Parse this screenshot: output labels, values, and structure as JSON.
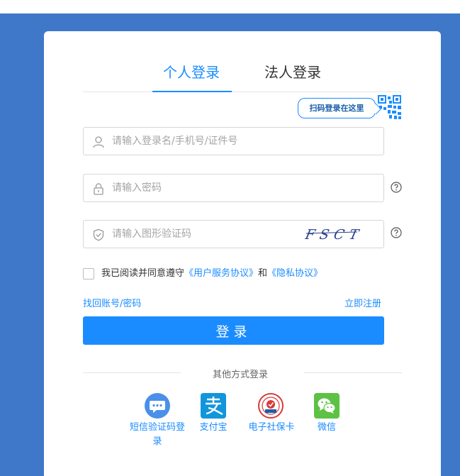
{
  "tabs": [
    {
      "label": "个人登录"
    },
    {
      "label": "法人登录"
    }
  ],
  "qr": {
    "bubble_text": "扫码登录在这里"
  },
  "form": {
    "username_placeholder": "请输入登录名/手机号/证件号",
    "password_placeholder": "请输入密码",
    "captcha_placeholder": "请输入图形验证码",
    "captcha_text": "FSCT"
  },
  "agreement": {
    "prefix": "我已阅读并同意遵守",
    "service_link": "《用户服务协议》",
    "joiner": "和",
    "privacy_link": "《隐私协议》"
  },
  "links": {
    "find_account": "找回账号/密码",
    "register": "立即注册"
  },
  "login_button": "登录",
  "other_methods": {
    "label": "其他方式登录",
    "items": [
      {
        "label": "短信验证码登录",
        "icon": "sms-icon"
      },
      {
        "label": "支付宝",
        "icon": "alipay-icon"
      },
      {
        "label": "电子社保卡",
        "icon": "social-security-card-icon"
      },
      {
        "label": "微信",
        "icon": "wechat-icon"
      }
    ]
  },
  "colors": {
    "accent": "#1a8cff",
    "background": "#3f78c8",
    "alipay": "#1296db",
    "wechat": "#5dc144",
    "social_security": "#d63b3b"
  }
}
